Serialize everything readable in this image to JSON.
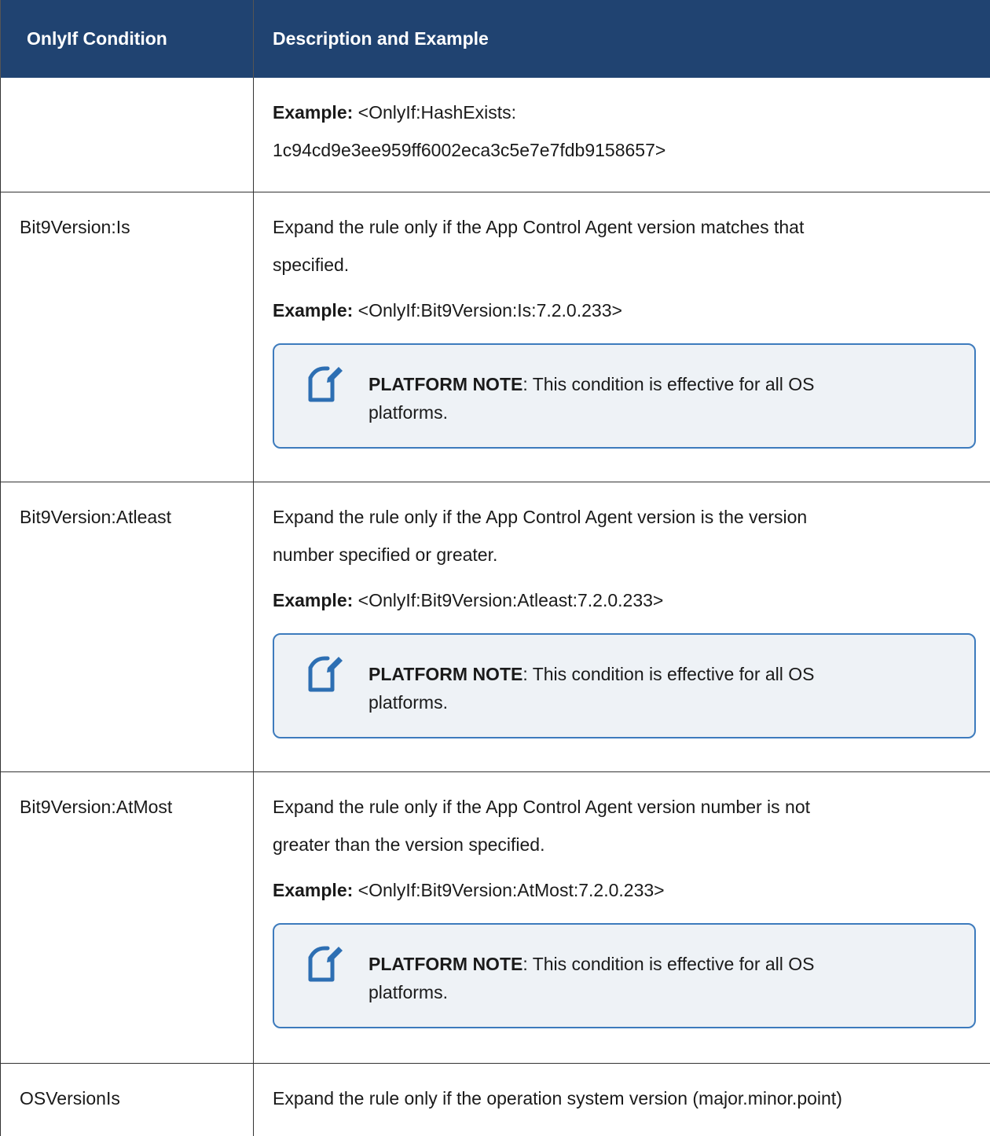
{
  "header": {
    "col1": "OnlyIf Condition",
    "col2": "Description and Example"
  },
  "rows": [
    {
      "condition": "",
      "example_label": "Example:",
      "example_text": " <OnlyIf:HashExists:",
      "example_cont": "1c94cd9e3ee959ff6002eca3c5e7e7fdb9158657>"
    },
    {
      "condition": "Bit9Version:Is",
      "description_l1": "Expand the rule only if the App Control Agent version matches that",
      "description_l2": "specified.",
      "example_label": "Example:",
      "example_text": " <OnlyIf:Bit9Version:Is:7.2.0.233>",
      "note_label": "PLATFORM NOTE",
      "note_text": ": This condition is effective for all OS",
      "note_text2": "platforms."
    },
    {
      "condition": "Bit9Version:Atleast",
      "description_l1": "Expand the rule only if the App Control Agent version is the version",
      "description_l2": "number specified or greater.",
      "example_label": "Example:",
      "example_text": " <OnlyIf:Bit9Version:Atleast:7.2.0.233>",
      "note_label": "PLATFORM NOTE",
      "note_text": ": This condition is effective for all OS",
      "note_text2": "platforms."
    },
    {
      "condition": "Bit9Version:AtMost",
      "description_l1": "Expand the rule only if the App Control Agent version number is not",
      "description_l2": "greater than the version specified.",
      "example_label": "Example:",
      "example_text": " <OnlyIf:Bit9Version:AtMost:7.2.0.233>",
      "note_label": "PLATFORM NOTE",
      "note_text": ": This condition is effective for all OS",
      "note_text2": "platforms."
    },
    {
      "condition": "OSVersionIs",
      "description_l1": "Expand the rule only if the operation system version (major.minor.point)"
    }
  ],
  "icons": {
    "note": "note-pencil-icon"
  },
  "colors": {
    "header_bg": "#204371",
    "note_border": "#3d7bbd",
    "note_bg": "#eef2f6"
  }
}
